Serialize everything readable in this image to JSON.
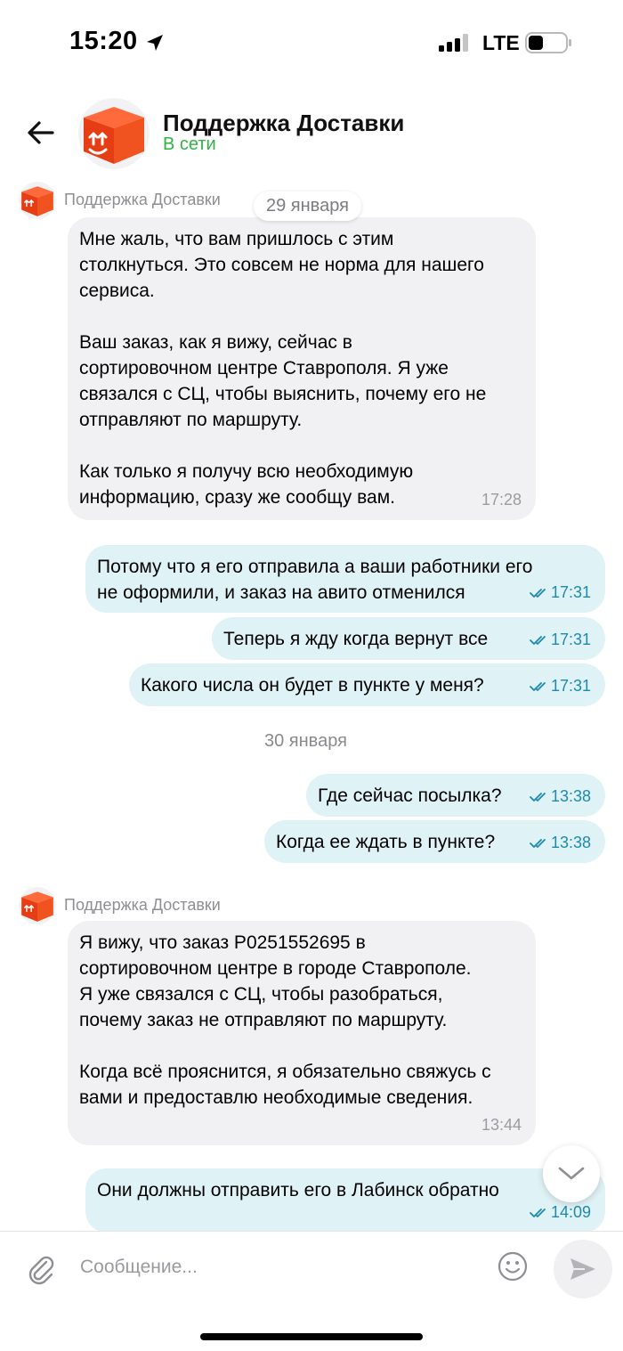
{
  "status_bar": {
    "time": "15:20",
    "network": "LTE"
  },
  "header": {
    "title": "Поддержка Доставки",
    "status": "В сети"
  },
  "feed": {
    "sender_1": "Поддержка Доставки",
    "date_1": "29 января",
    "msg_1": {
      "text": "Мне жаль, что вам пришлось с этим\nстолкнуться. Это совсем не норма для нашего\nсервиса.\n\nВаш заказ, как я вижу, сейчас в\nсортировочном центре Ставрополя. Я уже\nсвязался с СЦ, чтобы выяснить, почему его не\nотправляют по маршруту.\n\nКак только я получу всю необходимую\nинформацию, сразу же сообщу вам.",
      "time": "17:28"
    },
    "msg_2": {
      "text": "Потому что я его отправила а ваши работники его\nне оформили, и заказ на авито отменился",
      "time": "17:31"
    },
    "msg_3": {
      "text": "Теперь я жду когда вернут все",
      "time": "17:31"
    },
    "msg_4": {
      "text": "Какого числа он будет в пункте у меня?",
      "time": "17:31"
    },
    "date_2": "30 января",
    "msg_5": {
      "text": "Где сейчас посылка?",
      "time": "13:38"
    },
    "msg_6": {
      "text": "Когда ее ждать в пункте?",
      "time": "13:38"
    },
    "sender_2": "Поддержка Доставки",
    "msg_7": {
      "text": "Я вижу, что заказ P0251552695 в\nсортировочном центре в городе Ставрополе.\nЯ уже связался с СЦ, чтобы разобраться,\nпочему заказ не отправляют по маршруту.\n\nКогда всё прояснится, я обязательно свяжусь с\nвами и предоставлю необходимые сведения.",
      "time": "13:44"
    },
    "msg_8": {
      "text": "Они должны отправить его в Лабинск обратно",
      "time": "14:09"
    }
  },
  "composer": {
    "placeholder": "Сообщение..."
  },
  "colors": {
    "accent_online": "#2fb343",
    "incoming_bubble": "#f1f1f3",
    "outgoing_bubble": "#dff2f6",
    "read_check": "#1e8ab2",
    "brand_orange": "#f0441a"
  },
  "icons": [
    "location-arrow-icon",
    "signal-icon",
    "battery-icon",
    "back-arrow-icon",
    "box-logo-icon",
    "double-check-icon",
    "chevron-down-icon",
    "paperclip-icon",
    "emoji-icon",
    "send-icon"
  ]
}
